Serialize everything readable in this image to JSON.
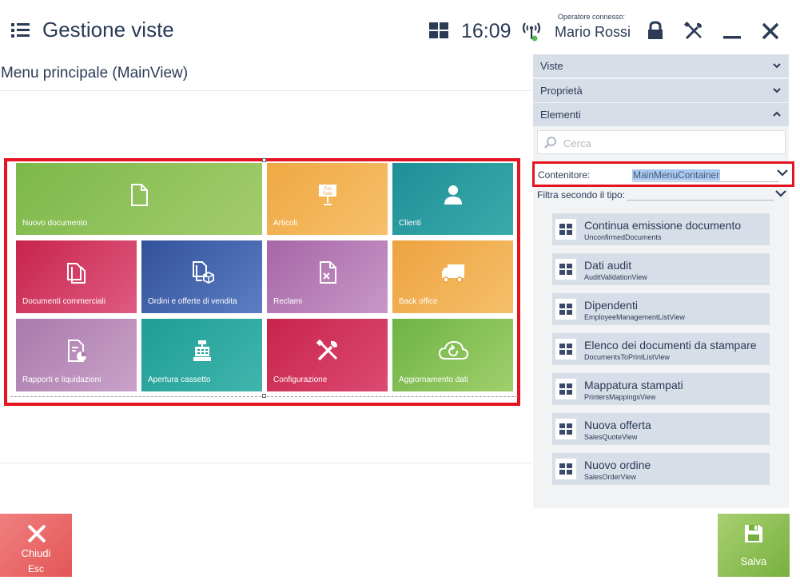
{
  "header": {
    "title": "Gestione viste",
    "time": "16:09",
    "operator_label": "Operatore connesso:",
    "operator_name": "Mario Rossi"
  },
  "view": {
    "title": "Menu principale (MainView)"
  },
  "tiles": [
    {
      "label": "Nuovo documento",
      "icon": "document-icon",
      "color": "#8bc34a"
    },
    {
      "label": "Articoli",
      "icon": "for-sale-sign-icon",
      "color": "#f4b04a"
    },
    {
      "label": "Clienti",
      "icon": "user-icon",
      "color": "#2a9ea0"
    },
    {
      "label": "Documenti commerciali",
      "icon": "documents-icon",
      "color": "#d6325e"
    },
    {
      "label": "Ordini e offerte di vendita",
      "icon": "document-package-icon",
      "color": "#3f5ea8"
    },
    {
      "label": "Reclami",
      "icon": "document-x-icon",
      "color": "#b67fb6"
    },
    {
      "label": "Back office",
      "icon": "truck-icon",
      "color": "#f2a84a"
    },
    {
      "label": "Rapporti e liquidazioni",
      "icon": "report-icon",
      "color": "#b78ab8"
    },
    {
      "label": "Apertura cassetto",
      "icon": "cash-register-icon",
      "color": "#32a89c"
    },
    {
      "label": "Configurazione",
      "icon": "tools-icon",
      "color": "#d6325e"
    },
    {
      "label": "Aggiornamento dati",
      "icon": "cloud-refresh-icon",
      "color": "#7cbf50"
    }
  ],
  "panel": {
    "sections": [
      {
        "label": "Viste",
        "state": "collapsed"
      },
      {
        "label": "Proprietà",
        "state": "collapsed"
      },
      {
        "label": "Elementi",
        "state": "expanded"
      }
    ],
    "search_placeholder": "Cerca",
    "container_label": "Contenitore:",
    "container_value": "MainMenuContainer",
    "filter_label": "Filtra secondo il tipo:",
    "items": [
      {
        "name": "Continua emissione documento",
        "sub": "UnconfirmedDocuments"
      },
      {
        "name": "Dati audit",
        "sub": "AuditValidationView"
      },
      {
        "name": "Dipendenti",
        "sub": "EmployeeManagementListView"
      },
      {
        "name": "Elenco dei documenti da stampare",
        "sub": "DocumentsToPrintListView"
      },
      {
        "name": "Mappatura stampati",
        "sub": "PrintersMappingsView"
      },
      {
        "name": "Nuova offerta",
        "sub": "SalesQuoteView"
      },
      {
        "name": "Nuovo ordine",
        "sub": "SalesOrderView"
      }
    ]
  },
  "footer": {
    "close_label": "Chiudi",
    "close_shortcut": "Esc",
    "save_label": "Salva"
  },
  "colors": {
    "accent_text": "#2b3a55",
    "highlight_border": "#e3141f",
    "close_button": "#e35656",
    "save_button": "#78b040"
  }
}
